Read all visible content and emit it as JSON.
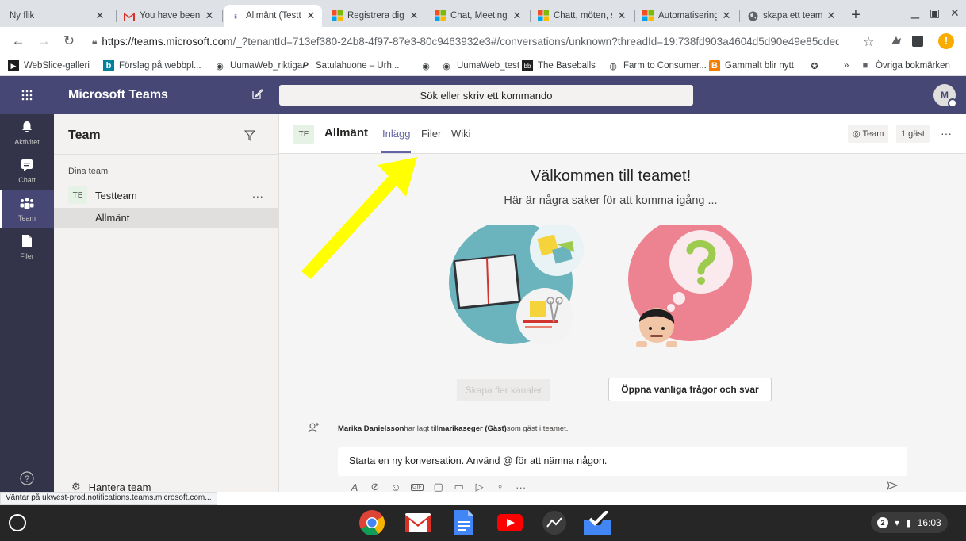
{
  "browser": {
    "tabs": [
      {
        "title": "Ny flik",
        "icon": "blank-tab-icon"
      },
      {
        "title": "You have been",
        "icon": "gmail-icon"
      },
      {
        "title": "Allmänt (Testte",
        "icon": "teams-icon"
      },
      {
        "title": "Registrera dig f",
        "icon": "microsoft-icon"
      },
      {
        "title": "Chat, Meetings,",
        "icon": "microsoft-icon"
      },
      {
        "title": "Chatt, möten, s",
        "icon": "microsoft-icon"
      },
      {
        "title": "Automatisering",
        "icon": "microsoft-icon"
      },
      {
        "title": "skapa ett team",
        "icon": "globe-icon"
      }
    ],
    "address": {
      "domain": "https://teams.microsoft.com",
      "path": "/_?tenantId=713ef380-24b8-4f97-87e3-80c9463932e3#/conversations/unknown?threadId=19:738fd903a4604d5d90e49e85cdedf2e4@thr..."
    },
    "bookmarks": [
      "WebSlice-galleri",
      "Förslag på webbpl...",
      "UumaWeb_riktiga",
      "Satulahuone – Urh...",
      "",
      "UumaWeb_test",
      "The Baseballs",
      "Farm to Consumer...",
      "Gammalt blir nytt",
      ""
    ],
    "bookmarks_more": "»",
    "other_bookmarks": "Övriga bokmärken",
    "status_url": "Väntar på ukwest-prod.notifications.teams.microsoft.com..."
  },
  "teams": {
    "app_title": "Microsoft Teams",
    "search_placeholder": "Sök eller skriv ett kommando",
    "avatar_initials": "M",
    "rail": [
      {
        "label": "Aktivitet",
        "icon": "bell-icon"
      },
      {
        "label": "Chatt",
        "icon": "chat-icon"
      },
      {
        "label": "Team",
        "icon": "team-icon"
      },
      {
        "label": "Filer",
        "icon": "file-icon"
      }
    ],
    "team_list": {
      "title": "Team",
      "section": "Dina team",
      "team_initials": "TE",
      "team_name": "Testteam",
      "more": "...",
      "channel": "Allmänt",
      "manage": "Hantera team"
    },
    "channel": {
      "initials": "TE",
      "name": "Allmänt",
      "tabs": [
        "Inlägg",
        "Filer",
        "Wiki"
      ],
      "team_button": "Team",
      "guest_button": "1 gäst",
      "more": "···",
      "welcome_title": "Välkommen till teamet!",
      "welcome_subtitle": "Här är några saker för att komma igång ...",
      "btn_create_channels": "Skapa fler kanaler",
      "btn_faq": "Öppna vanliga frågor och svar",
      "system_message": {
        "actor": "Marika Danielsson",
        "middle": " har lagt till ",
        "target": "marikaseger (Gäst)",
        "end": " som gäst i teamet."
      },
      "compose_placeholder": "Starta en ny konversation. Använd @ för att nämna någon."
    }
  },
  "shelf": {
    "tray_badge": "2",
    "time": "16:03"
  },
  "colors": {
    "teams_purple": "#464775",
    "rail": "#33344a",
    "accent": "#6264a7",
    "arrow": "#ffff00"
  }
}
